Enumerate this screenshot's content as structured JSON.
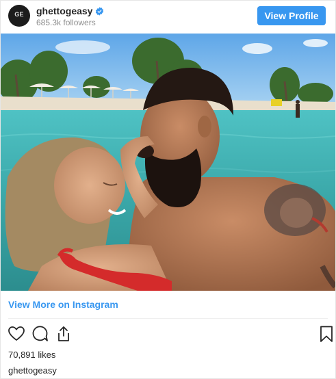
{
  "header": {
    "username": "ghettogeasy",
    "followers": "685.3k followers",
    "view_profile_label": "View Profile",
    "avatar_text": "GE"
  },
  "post": {
    "view_more_label": "View More on Instagram",
    "likes": "70,891 likes",
    "caption_username": "ghettogeasy"
  },
  "icons": [
    "verified-badge-icon",
    "heart-icon",
    "comment-icon",
    "share-icon",
    "bookmark-icon"
  ],
  "colors": {
    "accent": "#3897f0",
    "text": "#262626",
    "secondary_text": "#8e8e8e"
  }
}
